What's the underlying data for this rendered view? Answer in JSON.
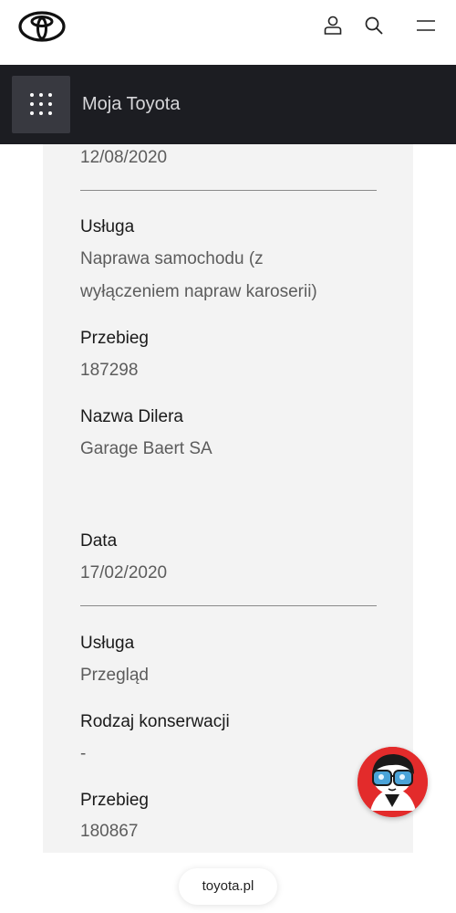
{
  "header": {
    "logo_icon": "toyota-logo-icon",
    "user_icon": "user-icon",
    "search_icon": "search-icon",
    "menu_icon": "hamburger-menu-icon"
  },
  "subnav": {
    "grid_icon": "grid-dots-icon",
    "title": "Moja Toyota"
  },
  "records": [
    {
      "date_value": "12/08/2020",
      "service_label": "Usługa",
      "service_value_line1": "Naprawa samochodu (z",
      "service_value_line2": "wyłączeniem napraw karoserii)",
      "mileage_label": "Przebieg",
      "mileage_value": "187298",
      "dealer_label": "Nazwa Dilera",
      "dealer_value": "Garage Baert SA"
    },
    {
      "date_label": "Data",
      "date_value": "17/02/2020",
      "service_label": "Usługa",
      "service_value": "Przegląd",
      "maintenance_label": "Rodzaj konserwacji",
      "maintenance_value": "-",
      "mileage_label": "Przebieg",
      "mileage_value": "180867"
    }
  ],
  "chat": {
    "icon": "chat-assistant-avatar-icon"
  },
  "footer": {
    "link_label": "toyota.pl"
  },
  "colors": {
    "subnav_bg": "#1c1d22",
    "card_bg": "#f3f3f3",
    "avatar_bg": "#e32b2b"
  }
}
